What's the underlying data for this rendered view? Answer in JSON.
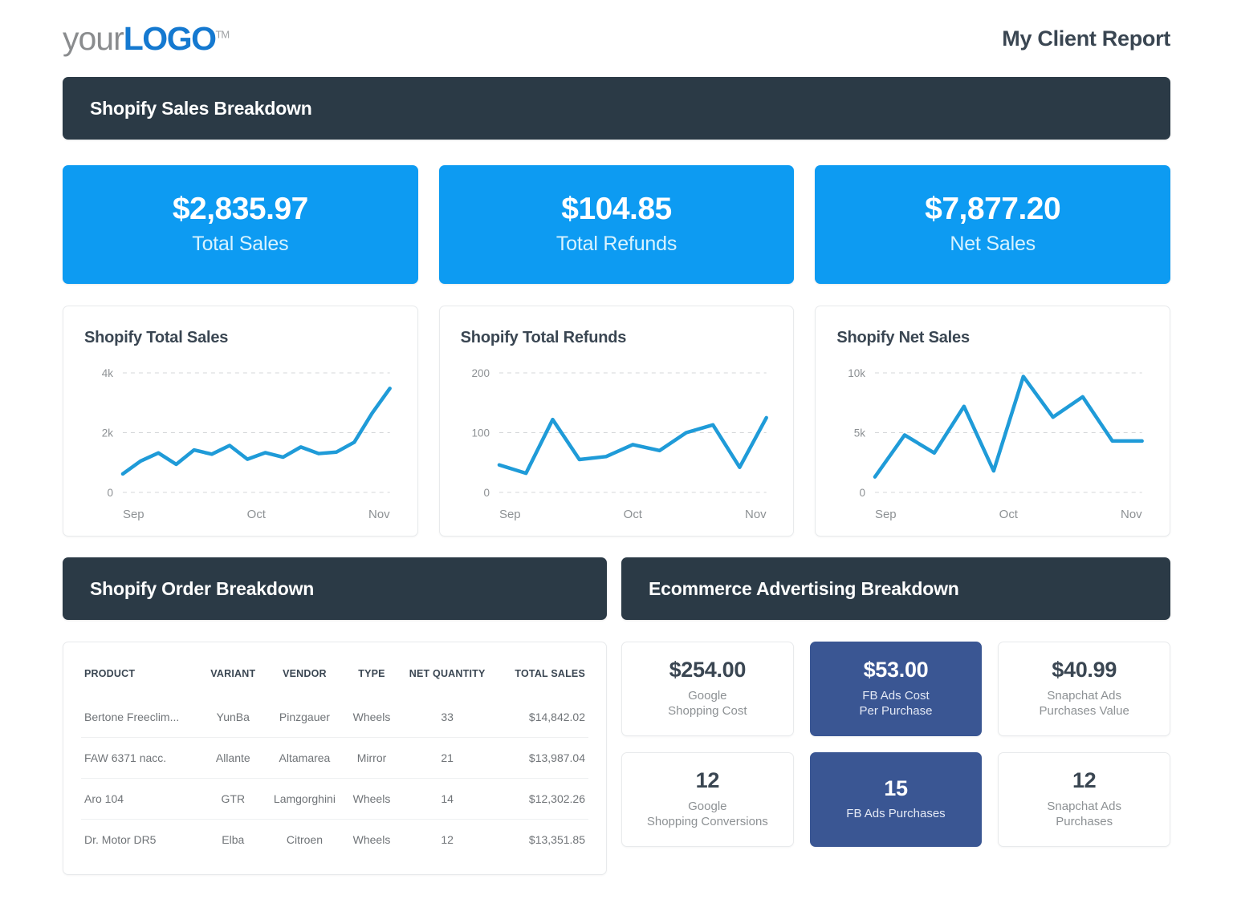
{
  "header": {
    "logo_your": "your",
    "logo_logo": "LOGO",
    "logo_tm": "TM",
    "report_title": "My Client Report"
  },
  "colors": {
    "dark_header": "#2b3a46",
    "kpi_blue": "#0d9bf2",
    "chart_line": "#1f9bd8",
    "fb_navy": "#3a5693",
    "text_dark": "#3a4652",
    "text_muted": "#8d9194"
  },
  "sections": {
    "sales_breakdown": "Shopify Sales Breakdown",
    "order_breakdown": "Shopify Order Breakdown",
    "advertising_breakdown": "Ecommerce Advertising Breakdown"
  },
  "kpis": [
    {
      "value": "$2,835.97",
      "label": "Total Sales"
    },
    {
      "value": "$104.85",
      "label": "Total Refunds"
    },
    {
      "value": "$7,877.20",
      "label": "Net Sales"
    }
  ],
  "chart_data": [
    {
      "type": "line",
      "title": "Shopify Total Sales",
      "xlabel": "",
      "ylabel": "",
      "ylim": [
        0,
        4000
      ],
      "yticks": [
        0,
        2000,
        4000
      ],
      "ytick_labels": [
        "0",
        "2k",
        "4k"
      ],
      "xtick_labels": [
        "Sep",
        "Oct",
        "Nov"
      ],
      "xtick_positions": [
        0,
        0.5,
        1
      ],
      "grid": true,
      "legend": "none",
      "values": [
        620,
        1050,
        1320,
        940,
        1420,
        1280,
        1570,
        1110,
        1330,
        1180,
        1520,
        1300,
        1350,
        1680,
        2650,
        3480
      ]
    },
    {
      "type": "line",
      "title": "Shopify Total Refunds",
      "xlabel": "",
      "ylabel": "",
      "ylim": [
        0,
        200
      ],
      "yticks": [
        0,
        100,
        200
      ],
      "ytick_labels": [
        "0",
        "100",
        "200"
      ],
      "xtick_labels": [
        "Sep",
        "Oct",
        "Nov"
      ],
      "xtick_positions": [
        0,
        0.5,
        1
      ],
      "grid": true,
      "legend": "none",
      "values": [
        46,
        32,
        122,
        55,
        60,
        80,
        70,
        100,
        113,
        42,
        125
      ]
    },
    {
      "type": "line",
      "title": "Shopify Net Sales",
      "xlabel": "",
      "ylabel": "",
      "ylim": [
        0,
        10000
      ],
      "yticks": [
        0,
        5000,
        10000
      ],
      "ytick_labels": [
        "0",
        "5k",
        "10k"
      ],
      "xtick_labels": [
        "Sep",
        "Oct",
        "Nov"
      ],
      "xtick_positions": [
        0,
        0.5,
        1
      ],
      "grid": true,
      "legend": "none",
      "values": [
        1300,
        4800,
        3300,
        7200,
        1800,
        9700,
        6300,
        8000,
        4300,
        4300
      ]
    }
  ],
  "order_table": {
    "columns": [
      "PRODUCT",
      "VARIANT",
      "VENDOR",
      "TYPE",
      "NET QUANTITY",
      "TOTAL SALES"
    ],
    "rows": [
      {
        "product": "Bertone Freeclim...",
        "variant": "YunBa",
        "vendor": "Pinzgauer",
        "type": "Wheels",
        "net_quantity": "33",
        "total_sales": "$14,842.02"
      },
      {
        "product": "FAW 6371 nacc.",
        "variant": "Allante",
        "vendor": "Altamarea",
        "type": "Mirror",
        "net_quantity": "21",
        "total_sales": "$13,987.04"
      },
      {
        "product": "Aro 104",
        "variant": "GTR",
        "vendor": "Lamgorghini",
        "type": "Wheels",
        "net_quantity": "14",
        "total_sales": "$12,302.26"
      },
      {
        "product": "Dr. Motor DR5",
        "variant": "Elba",
        "vendor": "Citroen",
        "type": "Wheels",
        "net_quantity": "12",
        "total_sales": "$13,351.85"
      }
    ]
  },
  "ad_cards": [
    {
      "value": "$254.00",
      "label_line1": "Google",
      "label_line2": "Shopping Cost",
      "highlight": false
    },
    {
      "value": "$53.00",
      "label_line1": "FB Ads Cost",
      "label_line2": "Per Purchase",
      "highlight": true
    },
    {
      "value": "$40.99",
      "label_line1": "Snapchat Ads",
      "label_line2": "Purchases Value",
      "highlight": false
    },
    {
      "value": "12",
      "label_line1": "Google",
      "label_line2": "Shopping Conversions",
      "highlight": false
    },
    {
      "value": "15",
      "label_line1": "FB Ads Purchases",
      "label_line2": "",
      "highlight": true
    },
    {
      "value": "12",
      "label_line1": "Snapchat Ads",
      "label_line2": "Purchases",
      "highlight": false
    }
  ]
}
